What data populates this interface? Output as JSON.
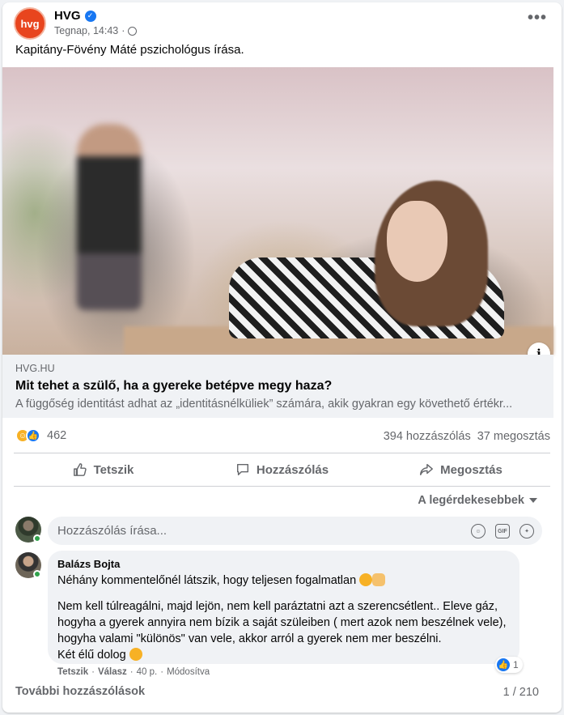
{
  "post": {
    "page_name": "HVG",
    "logo_text": "hvg",
    "time": "Tegnap, 14:43",
    "separator": "·",
    "text": "Kapitány-Fövény Máté pszichológus írása."
  },
  "link": {
    "domain": "HVG.HU",
    "title": "Mit tehet a szülő, ha a gyereke betépve megy haza?",
    "description": "A függőség identitást adhat az „identitásnélküliek” számára, akik gyakran egy követhető értékr..."
  },
  "stats": {
    "reaction_count": "462",
    "comments": "394 hozzászólás",
    "shares": "37 megosztás"
  },
  "actions": {
    "like": "Tetszik",
    "comment": "Hozzászólás",
    "share": "Megosztás"
  },
  "sort_label": "A legérdekesebbek",
  "comment_input": {
    "placeholder": "Hozzászólás írása..."
  },
  "comment": {
    "author": "Balázs Bojta",
    "line1": "Néhány kommentelőnél látszik, hogy teljesen fogalmatlan",
    "para2": "Nem kell túlreagálni, majd lejön, nem kell paráztatni azt a szerencsétlent.. Eleve gáz, hogyha a gyerek annyira nem bízik a saját szüleiben ( mert azok nem beszélnek vele), hogyha valami \"különös\" van vele, akkor arról a gyerek nem mer beszélni.",
    "line_last": "Két élű dolog",
    "like_count": "1",
    "meta_like": "Tetszik",
    "meta_reply": "Válasz",
    "meta_time": "40 p.",
    "meta_edited": "Módosítva",
    "dot": "·"
  },
  "more_comments": "További hozzászólások",
  "pager": "1 / 210",
  "colors": {
    "brand": "#e8451e",
    "facebook_blue": "#1877f2",
    "secondary_text": "#65676b"
  },
  "icons": [
    "verified-badge-icon",
    "globe-icon",
    "more-options-icon",
    "info-icon",
    "haha-reaction-icon",
    "like-reaction-icon",
    "like-thumb-icon",
    "comment-bubble-icon",
    "share-arrow-icon",
    "emoji-icon",
    "gif-icon",
    "sticker-icon",
    "caret-down-icon"
  ]
}
